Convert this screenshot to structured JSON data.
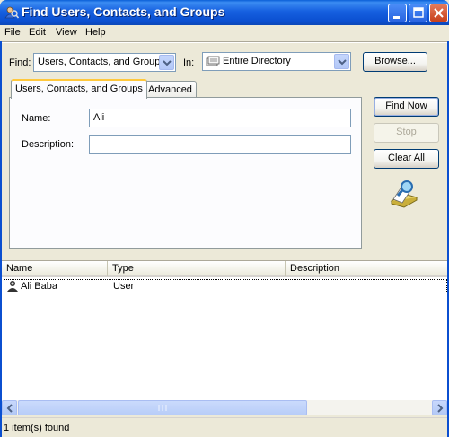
{
  "window": {
    "title": "Find Users, Contacts, and Groups"
  },
  "menu": [
    {
      "label": "File"
    },
    {
      "label": "Edit"
    },
    {
      "label": "View"
    },
    {
      "label": "Help"
    }
  ],
  "find_row": {
    "find_label": "Find:",
    "find_value": "Users, Contacts, and Groups",
    "in_label": "In:",
    "in_value": "Entire Directory",
    "browse_label": "Browse..."
  },
  "tabs": [
    {
      "label": "Users, Contacts, and Groups",
      "active": true
    },
    {
      "label": "Advanced",
      "active": false
    }
  ],
  "form": {
    "name_label": "Name:",
    "name_value": "Ali",
    "description_label": "Description:",
    "description_value": ""
  },
  "actions": {
    "find_now": "Find Now",
    "stop": "Stop",
    "clear_all": "Clear All"
  },
  "results": {
    "columns": [
      "Name",
      "Type",
      "Description"
    ],
    "rows": [
      {
        "name": "Ali Baba",
        "type": "User",
        "description": ""
      }
    ]
  },
  "status": {
    "text": "1 item(s) found"
  },
  "colors": {
    "titlebar": "#0b4fd0",
    "accent": "#ffc83c",
    "border": "#7f9db9"
  }
}
